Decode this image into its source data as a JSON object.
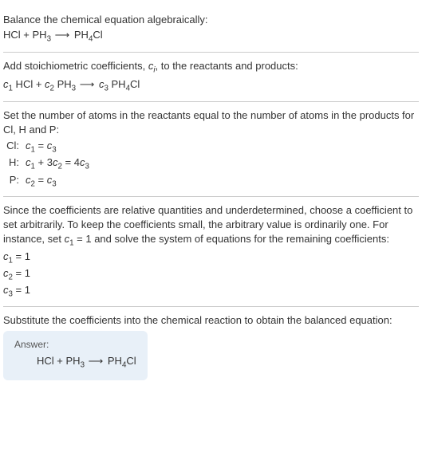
{
  "section1": {
    "text": "Balance the chemical equation algebraically:",
    "eq_lhs1": "HCl",
    "eq_plus": " + ",
    "eq_lhs2_base": "PH",
    "eq_lhs2_sub": "3",
    "eq_arrow": " ⟶ ",
    "eq_rhs_base": "PH",
    "eq_rhs_sub": "4",
    "eq_rhs_suffix": "Cl"
  },
  "section2": {
    "text_a": "Add stoichiometric coefficients, ",
    "ci_c": "c",
    "ci_i": "i",
    "text_b": ", to the reactants and products:",
    "c1": "c",
    "c1sub": "1",
    "hcl": " HCl + ",
    "c2": "c",
    "c2sub": "2",
    "ph3_base": " PH",
    "ph3_sub": "3",
    "arrow": " ⟶ ",
    "c3": "c",
    "c3sub": "3",
    "ph4_base": " PH",
    "ph4_sub": "4",
    "ph4_suffix": "Cl"
  },
  "section3": {
    "text": "Set the number of atoms in the reactants equal to the number of atoms in the products for Cl, H and P:",
    "rows": [
      {
        "label": "Cl:",
        "c1": "c",
        "c1s": "1",
        "mid": " = ",
        "c3": "c",
        "c3s": "3",
        "extra": ""
      },
      {
        "label": "H:",
        "c1": "c",
        "c1s": "1",
        "mid": " + 3",
        "c2": "c",
        "c2s": "2",
        "eq": " = 4",
        "c3": "c",
        "c3s": "3"
      },
      {
        "label": "P:",
        "c1": "c",
        "c1s": "2",
        "mid": " = ",
        "c3": "c",
        "c3s": "3",
        "extra": ""
      }
    ]
  },
  "section4": {
    "text_a": "Since the coefficients are relative quantities and underdetermined, choose a coefficient to set arbitrarily. To keep the coefficients small, the arbitrary value is ordinarily one. For instance, set ",
    "c": "c",
    "csub": "1",
    "text_b": " = 1 and solve the system of equations for the remaining coefficients:",
    "lines": [
      {
        "c": "c",
        "s": "1",
        "v": " = 1"
      },
      {
        "c": "c",
        "s": "2",
        "v": " = 1"
      },
      {
        "c": "c",
        "s": "3",
        "v": " = 1"
      }
    ]
  },
  "section5": {
    "text": "Substitute the coefficients into the chemical reaction to obtain the balanced equation:",
    "answer_label": "Answer:",
    "eq_lhs1": "HCl",
    "eq_plus": " + ",
    "eq_lhs2_base": "PH",
    "eq_lhs2_sub": "3",
    "eq_arrow": " ⟶ ",
    "eq_rhs_base": "PH",
    "eq_rhs_sub": "4",
    "eq_rhs_suffix": "Cl"
  },
  "chart_data": {
    "type": "table",
    "title": "Chemical equation balancing",
    "reactants": [
      "HCl",
      "PH3"
    ],
    "products": [
      "PH4Cl"
    ],
    "atom_balance": [
      {
        "element": "Cl",
        "equation": "c1 = c3"
      },
      {
        "element": "H",
        "equation": "c1 + 3 c2 = 4 c3"
      },
      {
        "element": "P",
        "equation": "c2 = c3"
      }
    ],
    "solution": {
      "c1": 1,
      "c2": 1,
      "c3": 1
    },
    "balanced_equation": "HCl + PH3 ⟶ PH4Cl"
  }
}
